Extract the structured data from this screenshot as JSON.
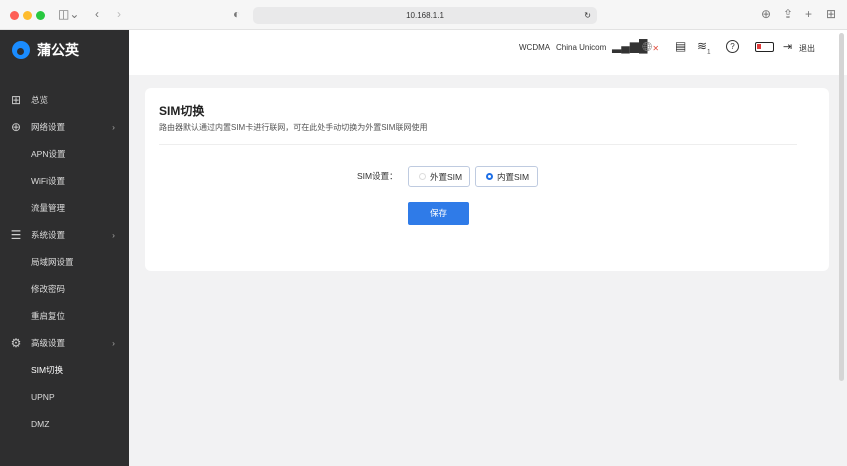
{
  "browser": {
    "url": "10.168.1.1"
  },
  "sidebar": {
    "brand": "蒲公英",
    "items": [
      {
        "label": "总览",
        "icon": "grid-icon"
      },
      {
        "label": "网络设置",
        "icon": "globe-icon"
      },
      {
        "label": "APN设置"
      },
      {
        "label": "WiFi设置"
      },
      {
        "label": "流量管理"
      },
      {
        "label": "系统设置",
        "icon": "sliders-icon"
      },
      {
        "label": "局域网设置"
      },
      {
        "label": "修改密码"
      },
      {
        "label": "重启复位"
      },
      {
        "label": "高级设置",
        "icon": "gear-icon"
      },
      {
        "label": "SIM切换"
      },
      {
        "label": "UPNP"
      },
      {
        "label": "DMZ"
      }
    ]
  },
  "header": {
    "network_type": "WCDMA",
    "carrier": "China Unicom",
    "wifi_clients": "1",
    "logout": "退出"
  },
  "card": {
    "title": "SIM切换",
    "description": "路由器默认通过内置SIM卡进行联网，可在此处手动切换为外置SIM联网使用",
    "sim_label": "SIM设置：",
    "option_external": "外置SIM",
    "option_internal": "内置SIM",
    "selected": "内置SIM",
    "save": "保存"
  },
  "colors": {
    "accent": "#2f7be8",
    "sidebar": "#2e2e2f"
  }
}
